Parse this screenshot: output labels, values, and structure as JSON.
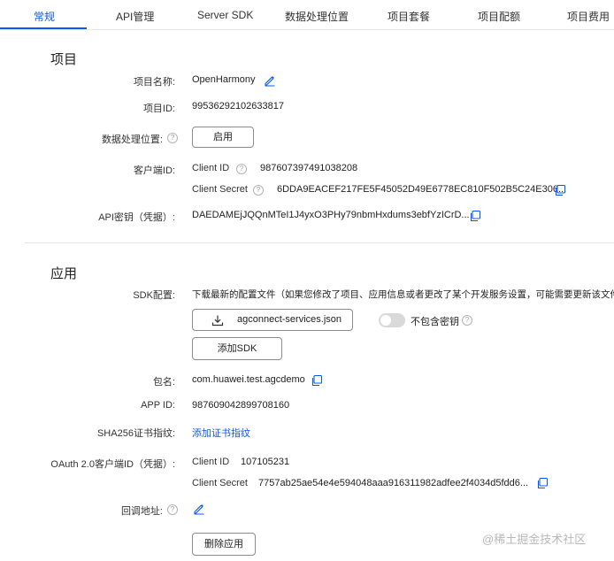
{
  "tabs": [
    {
      "label": "常规",
      "active": true
    },
    {
      "label": "API管理"
    },
    {
      "label": "Server SDK"
    },
    {
      "label": "数据处理位置"
    },
    {
      "label": "项目套餐"
    },
    {
      "label": "项目配额"
    },
    {
      "label": "项目费用"
    }
  ],
  "project": {
    "section_title": "项目",
    "name_label": "项目名称:",
    "name_value": "OpenHarmony",
    "id_label": "项目ID:",
    "id_value": "99536292102633817",
    "data_location_label": "数据处理位置:",
    "enable_button": "启用",
    "client_id_label": "客户端ID:",
    "client_id_sublabel": "Client ID",
    "client_id_value": "987607397491038208",
    "client_secret_sublabel": "Client Secret",
    "client_secret_value": "6DDA9EACEF217FE5F45052D49E6778EC810F502B5C24E306...",
    "api_key_label": "API密钥（凭据）:",
    "api_key_value": "DAEDAMEjJQQnMTeI1J4yxO3PHy79nbmHxdums3ebfYzICrD..."
  },
  "app": {
    "section_title": "应用",
    "sdk_label": "SDK配置:",
    "sdk_desc": "下载最新的配置文件（如果您修改了项目、应用信息或者更改了某个开发服务设置，可能需要更新该文件）",
    "download_button": "agconnect-services.json",
    "toggle_label": "不包含密钥",
    "add_sdk_button": "添加SDK",
    "package_label": "包名:",
    "package_value": "com.huawei.test.agcdemo",
    "app_id_label": "APP ID:",
    "app_id_value": "987609042899708160",
    "sha_label": "SHA256证书指纹:",
    "sha_link": "添加证书指纹",
    "oauth_label": "OAuth 2.0客户端ID（凭据）:",
    "oauth_client_id_sublabel": "Client ID",
    "oauth_client_id_value": "107105231",
    "oauth_client_secret_sublabel": "Client Secret",
    "oauth_client_secret_value": "7757ab25ae54e4e594048aaa916311982adfee2f4034d5fdd6...",
    "callback_label": "回调地址:",
    "delete_button": "删除应用"
  },
  "watermark": "@稀土掘金技术社区",
  "colors": {
    "accent": "#0a59f7",
    "text": "#222222",
    "border": "#8c8c8c"
  }
}
